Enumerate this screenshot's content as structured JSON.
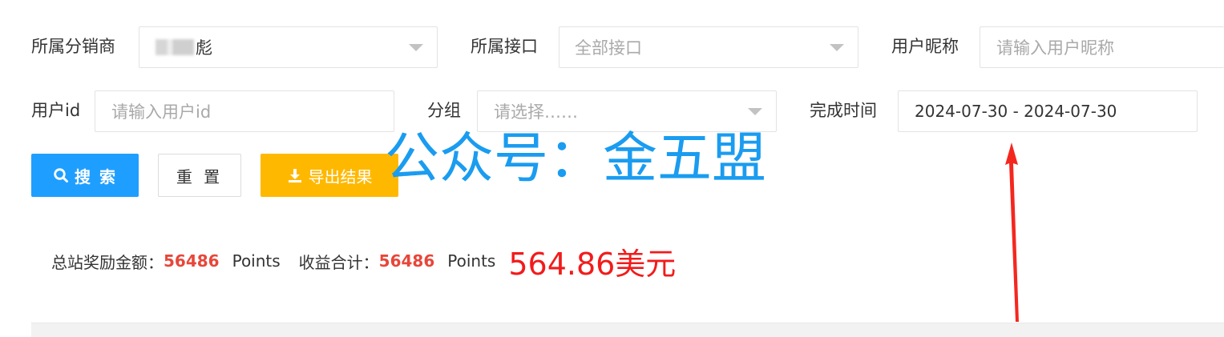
{
  "filters": {
    "distributor": {
      "label": "所属分销商",
      "value": "彪"
    },
    "interface": {
      "label": "所属接口",
      "value": "全部接口"
    },
    "nickname": {
      "label": "用户昵称",
      "placeholder": "请输入用户昵称"
    },
    "user_id": {
      "label": "用户id",
      "placeholder": "请输入用户id"
    },
    "group": {
      "label": "分组",
      "placeholder": "请选择……"
    },
    "finish_time": {
      "label": "完成时间",
      "value": "2024-07-30 - 2024-07-30"
    }
  },
  "buttons": {
    "search": "搜 索",
    "reset": "重 置",
    "export": "导出结果"
  },
  "watermark": "公众号：金五盟",
  "summary": {
    "total_label": "总站奖励金额：",
    "total_value": "56486",
    "total_unit": "Points",
    "income_label": "收益合计：",
    "income_value": "56486",
    "income_unit": "Points",
    "usd": "564.86美元"
  },
  "colors": {
    "primary": "#1e9fff",
    "warning": "#ffb800",
    "highlight": "#e8463a",
    "annotation": "#f21b1b"
  }
}
